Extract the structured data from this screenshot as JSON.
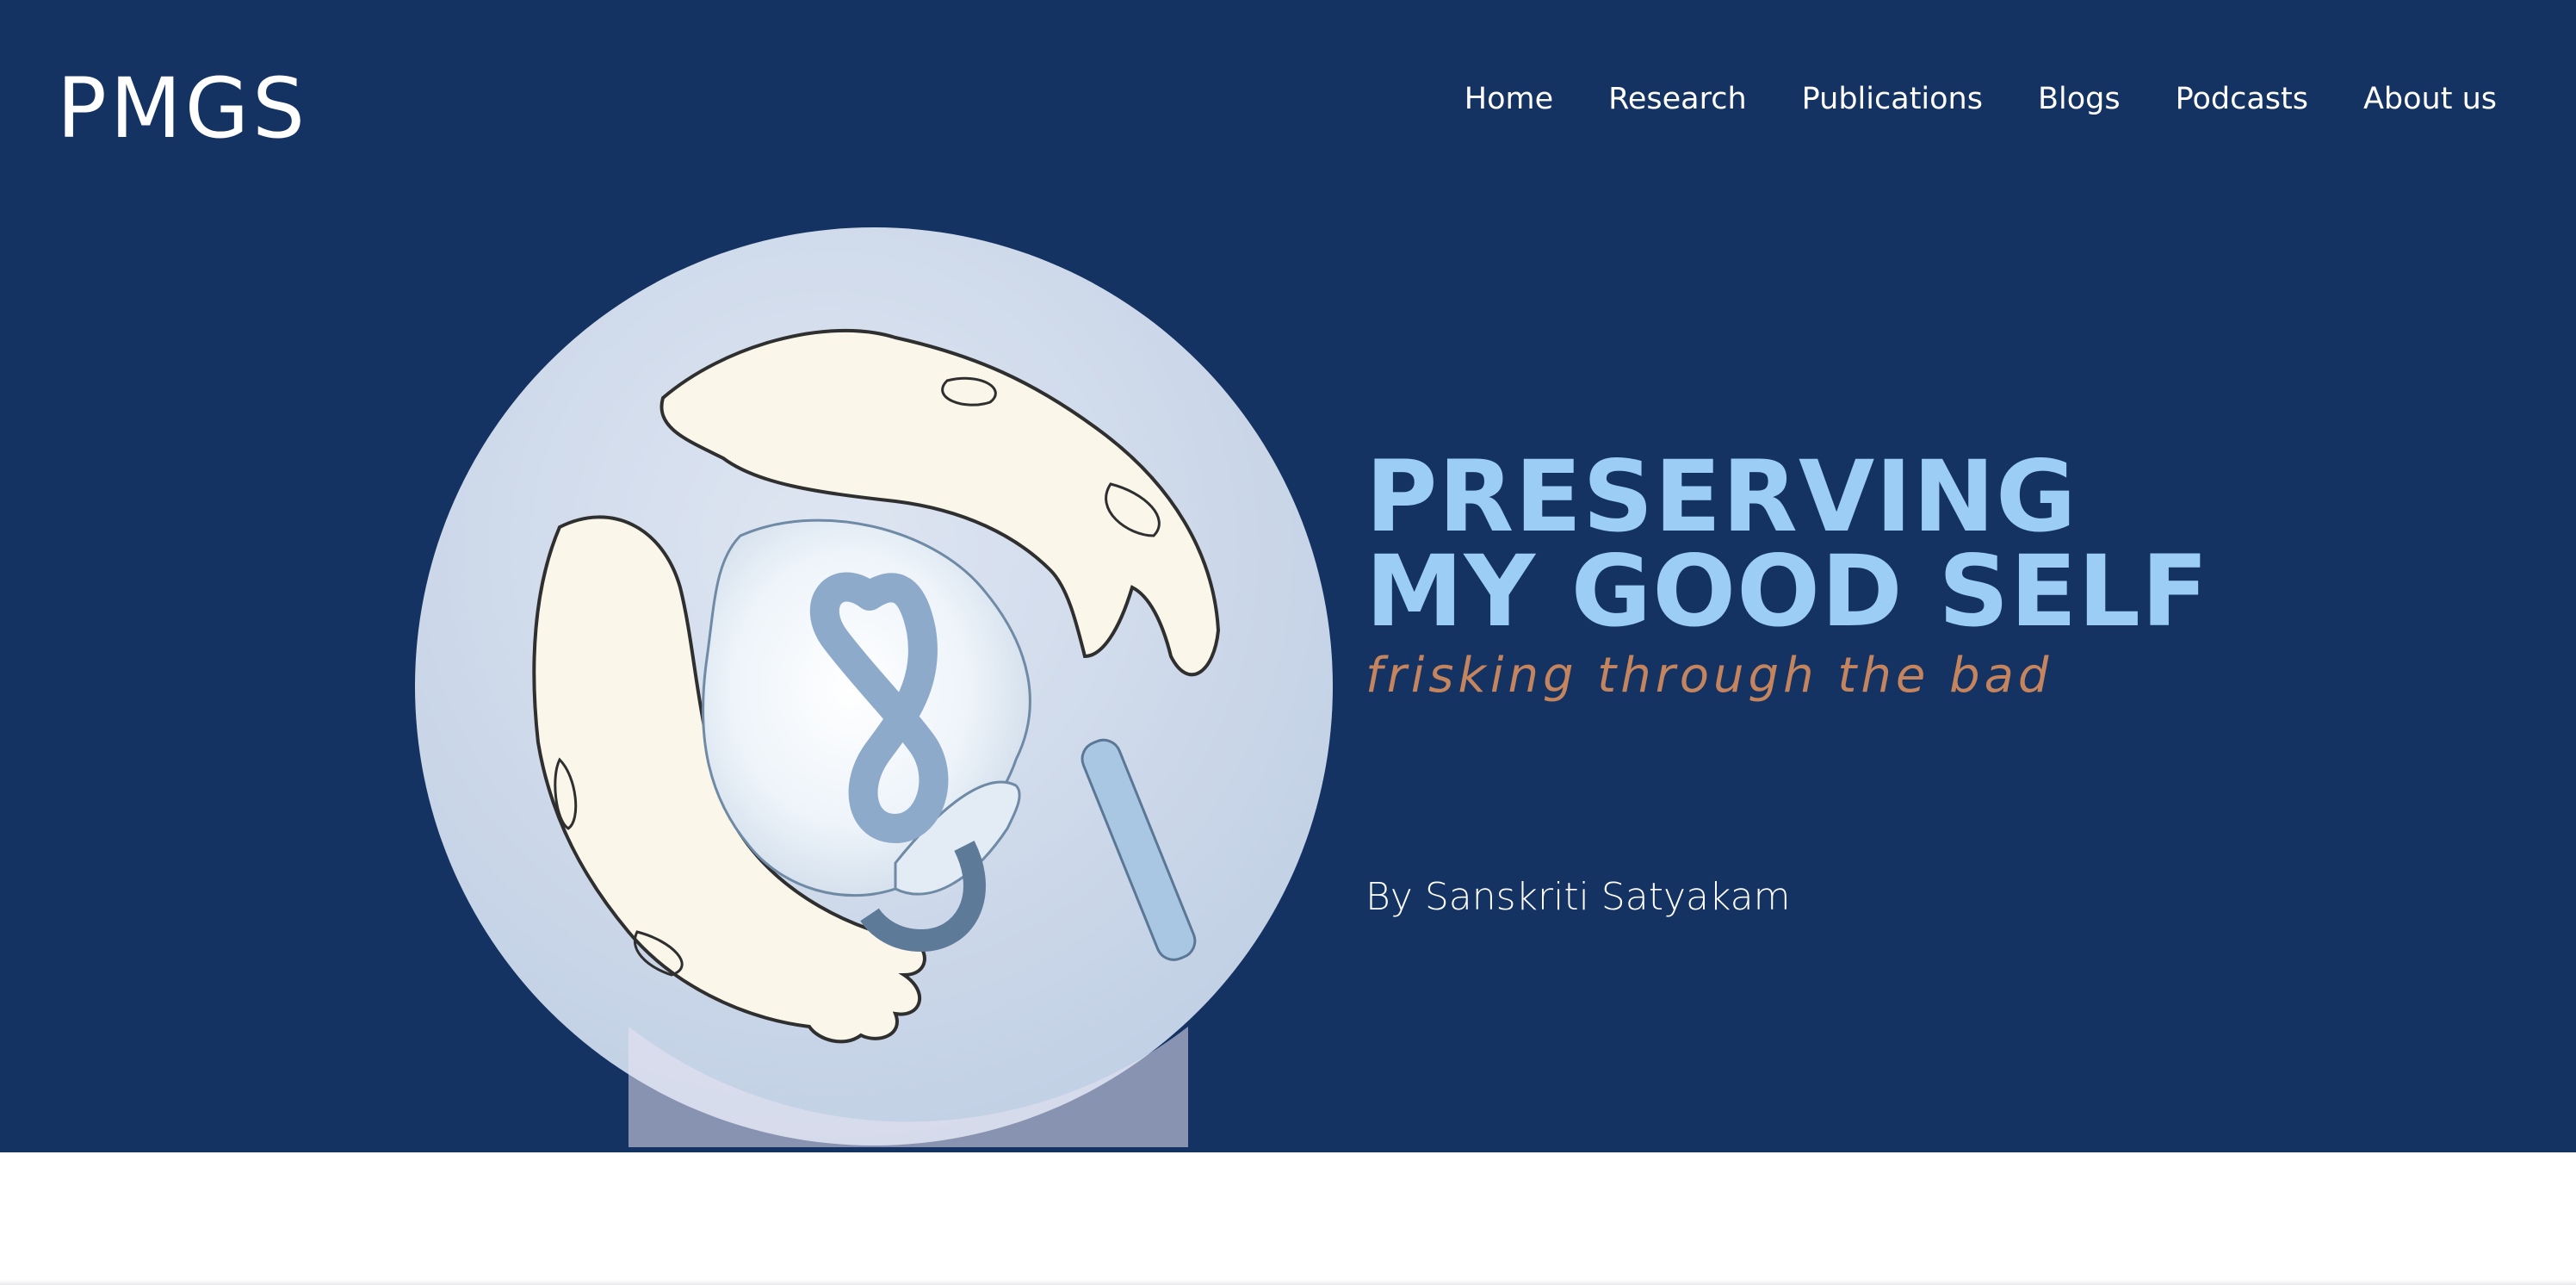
{
  "site": {
    "logo": "PMGS"
  },
  "nav": {
    "items": [
      "Home",
      "Research",
      "Publications",
      "Blogs",
      "Podcasts",
      "About us"
    ]
  },
  "hero": {
    "title_line1": "PRESERVING",
    "title_line2": "MY GOOD SELF",
    "subtitle": "frisking through the bad",
    "byline": "By Sanskriti Satyakam",
    "colors": {
      "background": "#143262",
      "title": "#9bcdf5",
      "subtitle": "#c4855e",
      "circle": "#c6d3e8"
    },
    "illustration": "hands-around-jar-infinity-icon"
  }
}
